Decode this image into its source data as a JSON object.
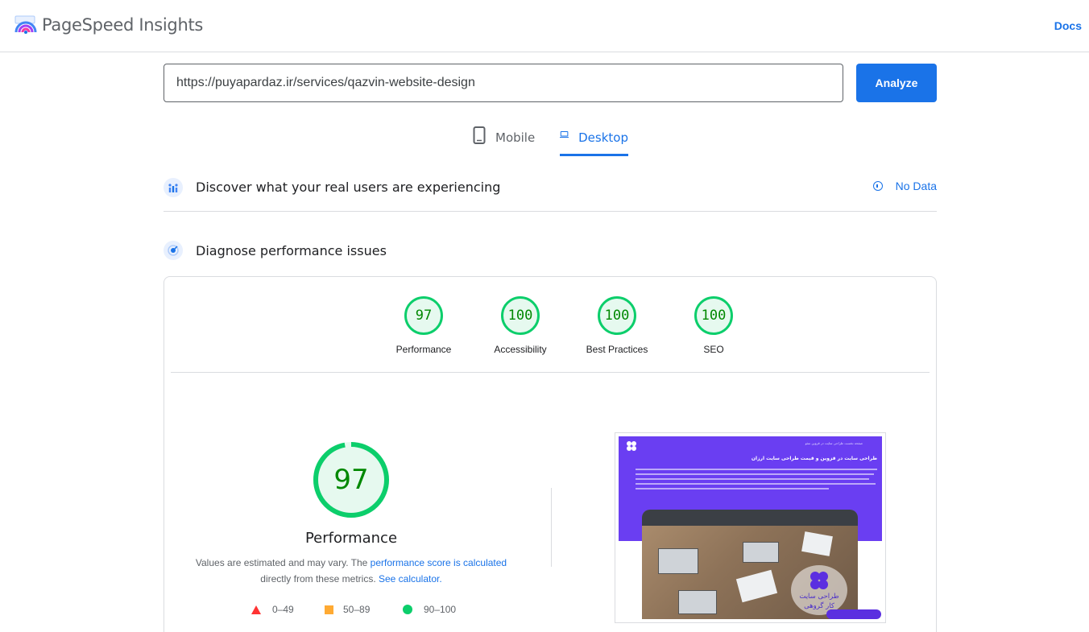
{
  "header": {
    "brand": "PageSpeed Insights",
    "docs_label": "Docs"
  },
  "search": {
    "url_value": "https://puyapardaz.ir/services/qazvin-website-design",
    "analyze_label": "Analyze"
  },
  "device_tabs": [
    {
      "label": "Mobile",
      "icon": "mobile-phone-icon",
      "selected": false
    },
    {
      "label": "Desktop",
      "icon": "laptop-icon",
      "selected": true
    }
  ],
  "field_data": {
    "title": "Discover what your real users are experiencing",
    "status": "No Data"
  },
  "lab_data": {
    "title": "Diagnose performance issues"
  },
  "categories": [
    {
      "score": "97",
      "label": "Performance"
    },
    {
      "score": "100",
      "label": "Accessibility"
    },
    {
      "score": "100",
      "label": "Best Practices"
    },
    {
      "score": "100",
      "label": "SEO"
    }
  ],
  "performance": {
    "score": "97",
    "score_fraction": 0.97,
    "title": "Performance",
    "desc_prefix": "Values are estimated and may vary. The ",
    "desc_link1": "performance score is calculated",
    "desc_middle": " directly from these metrics. ",
    "desc_link2": "See calculator.",
    "legend": [
      {
        "range": "0–49",
        "shape": "triangle",
        "color": "#ff3333"
      },
      {
        "range": "50–89",
        "shape": "square",
        "color": "#ffaa33"
      },
      {
        "range": "90–100",
        "shape": "circle",
        "color": "#0cce6b"
      }
    ]
  },
  "screenshot": {
    "heading": "طراحی سایت در قزوین و قیمت طراحی سایت ارزان",
    "nav": "صفحه نخست  طراحی سایت در قزوین  سئو",
    "badge_line1": "طراحی سایت",
    "badge_line2": "کار گروهی"
  },
  "colors": {
    "accent": "#1a73e8",
    "pass": "#0cce6b",
    "pass_text": "#008800",
    "site_purple": "#6a3ef2"
  }
}
